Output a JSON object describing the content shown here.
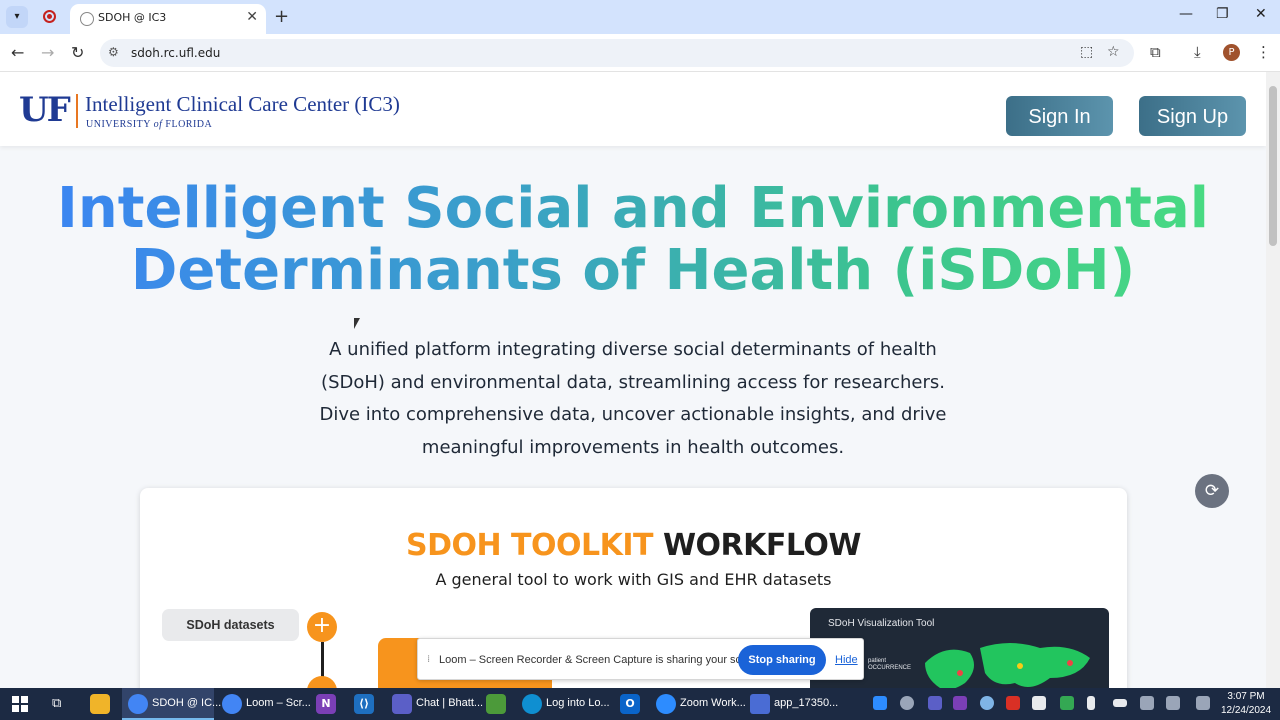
{
  "browser": {
    "tab_title": "SDOH @ IC3",
    "url": "sdoh.rc.ufl.edu",
    "profile_initial": "P"
  },
  "header": {
    "logo_text": "UF",
    "org_title": "Intelligent Clinical Care Center (IC3)",
    "org_sub_a": "UNIVERSITY ",
    "org_sub_of": "of",
    "org_sub_b": " FLORIDA",
    "sign_in": "Sign In",
    "sign_up": "Sign Up"
  },
  "hero": {
    "line1": "Intelligent Social and Environmental",
    "line2": "Determinants of Health (iSDoH)",
    "description": "A unified platform integrating diverse social determinants of health (SDoH) and environmental data, streamlining access for researchers. Dive into comprehensive data, uncover actionable insights, and drive meaningful improvements in health outcomes."
  },
  "workflow": {
    "title_a": "SDOH TOOLKIT",
    "title_b": " WORKFLOW",
    "subtitle": "A general tool to work with GIS and EHR datasets",
    "datasets_label": "SDoH datasets",
    "viz_title": "SDoH Visualization  Tool",
    "viz_label_1": "patient",
    "viz_label_2": "OCCURRENCE"
  },
  "loom": {
    "message": "Loom – Screen Recorder & Screen Capture is sharing your screen.",
    "stop": "Stop sharing",
    "hide": "Hide"
  },
  "taskbar": {
    "apps": [
      {
        "label": "SDOH @ IC...",
        "color": "#4285f4"
      },
      {
        "label": "Loom – Scr...",
        "color": "#4285f4"
      },
      {
        "label": "Chat | Bhatt...",
        "color": "#5b5fc7"
      },
      {
        "label": "Log into Lo...",
        "color": "#0f8fd1"
      },
      {
        "label": "Zoom Work...",
        "color": "#2d8cff"
      },
      {
        "label": "app_17350...",
        "color": "#4a6cd4"
      }
    ],
    "time": "3:07 PM",
    "date": "12/24/2024"
  },
  "colors": {
    "brand_blue": "#1f3a93",
    "accent_orange": "#f7941d",
    "button_teal": "#4a7f99"
  }
}
